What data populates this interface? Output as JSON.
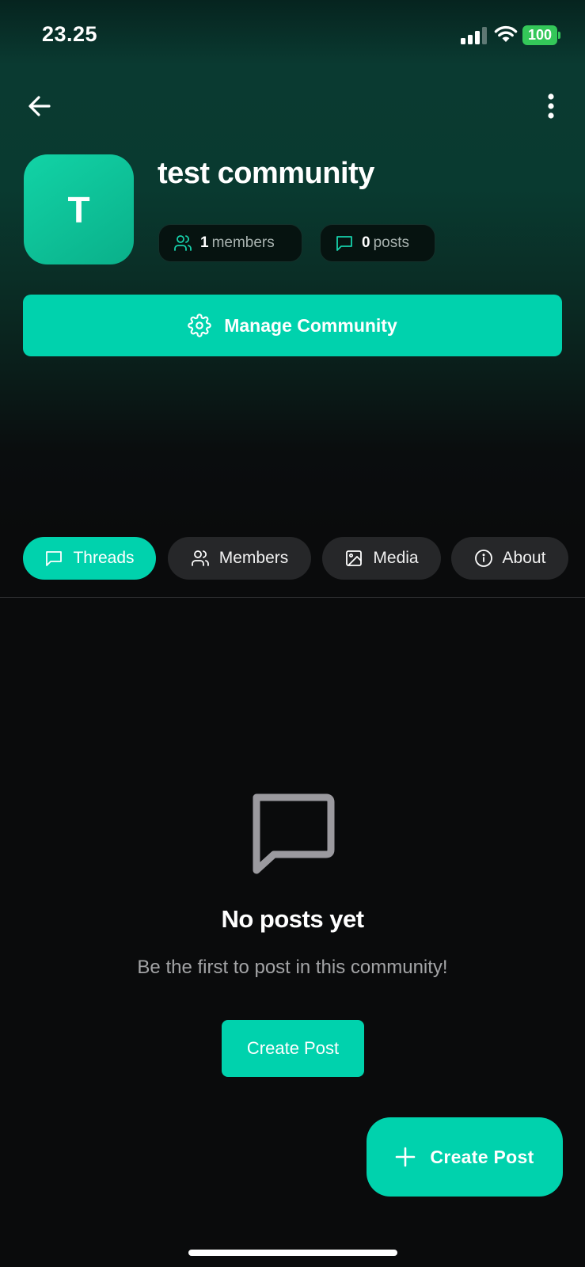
{
  "status_bar": {
    "time": "23.25",
    "battery": "100"
  },
  "community": {
    "initial": "T",
    "name": "test community",
    "members_count": "1",
    "members_label": "members",
    "posts_count": "0",
    "posts_label": "posts",
    "manage_label": "Manage Community"
  },
  "tabs": [
    {
      "label": "Threads",
      "icon": "chat-bubble-icon",
      "active": true
    },
    {
      "label": "Members",
      "icon": "users-icon",
      "active": false
    },
    {
      "label": "Media",
      "icon": "image-icon",
      "active": false
    },
    {
      "label": "About",
      "icon": "info-icon",
      "active": false
    }
  ],
  "empty_state": {
    "title": "No posts yet",
    "subtitle": "Be the first to post in this community!",
    "button_label": "Create Post"
  },
  "fab": {
    "label": "Create Post"
  },
  "colors": {
    "accent": "#00d2ad",
    "background": "#0a0b0c",
    "tab_inactive": "#262729"
  }
}
